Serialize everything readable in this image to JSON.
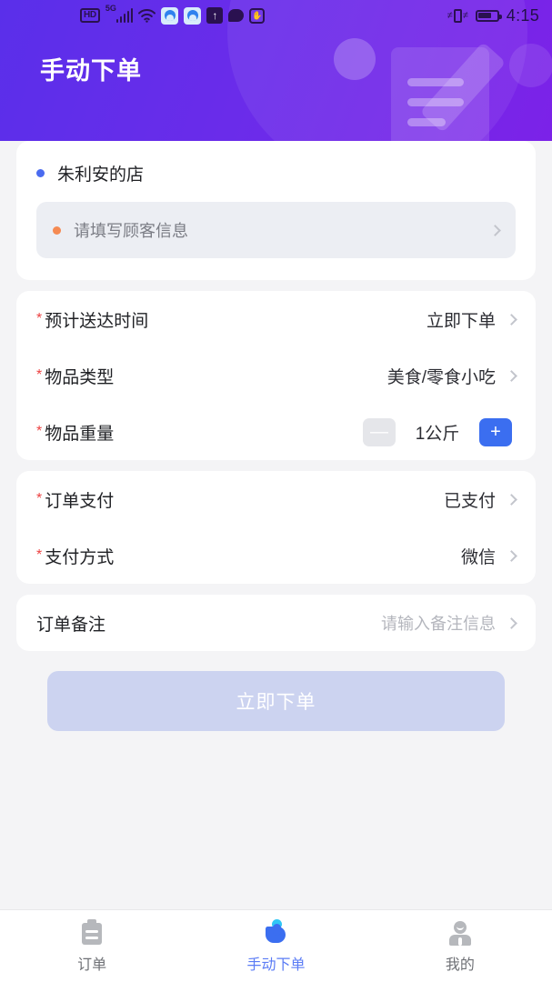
{
  "status_bar": {
    "hd_badge": "HD",
    "network": "5G",
    "time": "4:15",
    "icons": [
      "hd-badge-icon",
      "signal-5g-icon",
      "wifi-icon",
      "app-circle-icon",
      "app-circle-icon",
      "upload-arrow-icon",
      "chat-bubble-icon",
      "hexagon-hand-icon",
      "vibrate-icon",
      "battery-icon"
    ]
  },
  "header": {
    "title": "手动下单"
  },
  "store_card": {
    "store_name": "朱利安的店",
    "customer_placeholder": "请填写顾客信息"
  },
  "delivery_card": {
    "rows": [
      {
        "required": "*",
        "label": "预计送达时间",
        "value": "立即下单"
      },
      {
        "required": "*",
        "label": "物品类型",
        "value": "美食/零食小吃"
      }
    ],
    "weight_row": {
      "required": "*",
      "label": "物品重量",
      "minus_label": "—",
      "value": "1公斤",
      "plus_label": "+"
    }
  },
  "payment_card": {
    "rows": [
      {
        "required": "*",
        "label": "订单支付",
        "value": "已支付"
      },
      {
        "required": "*",
        "label": "支付方式",
        "value": "微信"
      }
    ]
  },
  "remark_card": {
    "label": "订单备注",
    "placeholder": "请输入备注信息"
  },
  "submit": {
    "label": "立即下单"
  },
  "tabbar": {
    "items": [
      {
        "label": "订单",
        "icon": "clipboard-icon",
        "active": false
      },
      {
        "label": "手动下单",
        "icon": "tap-hand-icon",
        "active": true
      },
      {
        "label": "我的",
        "icon": "person-icon",
        "active": false
      }
    ]
  },
  "colors": {
    "header_gradient_start": "#5a2fea",
    "header_gradient_end": "#7c22e8",
    "accent_blue": "#3b6ef0",
    "active_tab": "#5b7cf5",
    "required_red": "#ec4242",
    "dot_blue": "#4a6bf0",
    "dot_orange": "#f58a52",
    "submit_disabled": "#ccd3f0"
  }
}
